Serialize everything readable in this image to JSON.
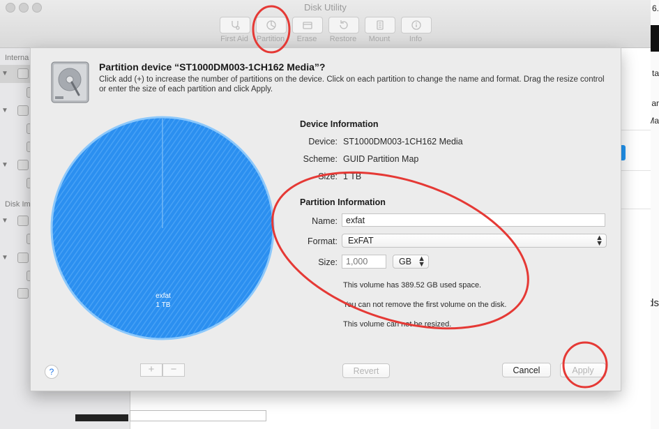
{
  "window": {
    "title": "Disk Utility",
    "edge_fragments": [
      "6.",
      "ta",
      "ar",
      "Ma",
      "ds"
    ]
  },
  "toolbar": {
    "items": [
      {
        "label": "First Aid",
        "icon": "stethoscope-icon"
      },
      {
        "label": "Partition",
        "icon": "pie-chart-icon"
      },
      {
        "label": "Erase",
        "icon": "eraser-icon"
      },
      {
        "label": "Restore",
        "icon": "restore-icon"
      },
      {
        "label": "Mount",
        "icon": "mount-icon"
      },
      {
        "label": "Info",
        "icon": "info-icon"
      }
    ]
  },
  "sidebar": {
    "internal_header": "Interna",
    "images_header": "Disk Im"
  },
  "sheet": {
    "title": "Partition device “ST1000DM003-1CH162 Media”?",
    "description": "Click add (+) to increase the number of partitions on the device. Click on each partition to change the name and format. Drag the resize control or enter the size of each partition and click Apply.",
    "pie": {
      "partition_name": "exfat",
      "partition_size": "1 TB",
      "fill_color": "#2b8ff0",
      "edge_color": "#8cc8fb"
    },
    "device_info": {
      "title": "Device Information",
      "device_label": "Device:",
      "device_value": "ST1000DM003-1CH162 Media",
      "scheme_label": "Scheme:",
      "scheme_value": "GUID Partition Map",
      "size_label": "Size:",
      "size_value": "1 TB"
    },
    "partition_info": {
      "title": "Partition Information",
      "name_label": "Name:",
      "name_value": "exfat",
      "format_label": "Format:",
      "format_value": "ExFAT",
      "size_label": "Size:",
      "size_placeholder": "1,000",
      "size_unit": "GB",
      "notes": [
        "This volume has 389.52 GB used space.",
        "You can not remove the first volume on the disk.",
        "This volume can not be resized."
      ]
    },
    "buttons": {
      "help": "?",
      "add": "+",
      "remove": "−",
      "revert": "Revert",
      "cancel": "Cancel",
      "apply": "Apply"
    }
  },
  "annotation_color": "#e53935"
}
